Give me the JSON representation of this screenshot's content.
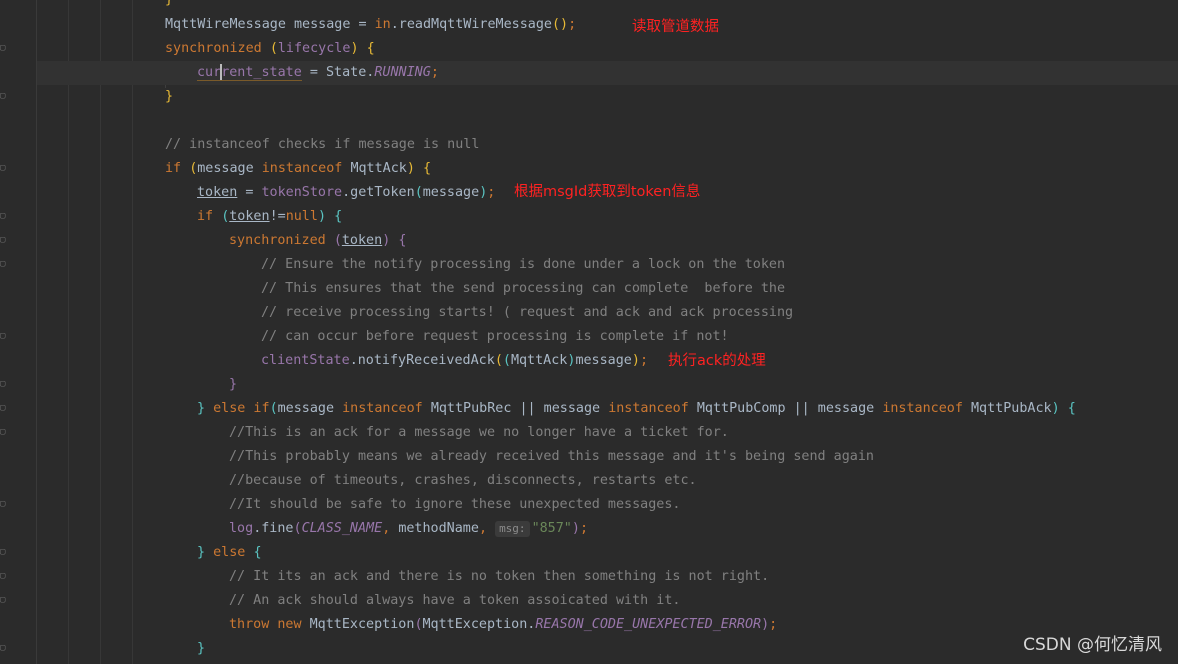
{
  "code": {
    "l0": {
      "a": "}"
    },
    "l1": {
      "t1": "MqttWireMessage message = ",
      "kin": "in",
      ".": ".",
      "call": "readMqttWireMessage",
      "p": "()",
      ";": ";"
    },
    "l2": {
      "kw": "synchronized ",
      "o": "(",
      "id": "lifecycle",
      "c": ")",
      " ": " ",
      "b": "{"
    },
    "l3": {
      "v1": "cur",
      "v2": "rent_state",
      "eq": " = State.",
      "run": "RUNNING",
      ";": ";"
    },
    "l4": {
      "b": "}"
    },
    "l5": {
      "c": "// instanceof checks if message is null"
    },
    "l6": {
      "kw": "if ",
      "o": "(",
      "m": "message ",
      "io": "instanceof ",
      "cls": "MqttAck",
      "c": ")",
      " ": " ",
      "b": "{"
    },
    "l7": {
      "tok": "token",
      "eq": " = ",
      "ts": "tokenStore",
      ".": ".getToken",
      "o": "(",
      "m": "message",
      "c": ")",
      ";": ";"
    },
    "l8": {
      "kw": "if ",
      "o": "(",
      "tok": "token",
      "ne": "!=",
      "nl": "null",
      "c": ")",
      " ": " ",
      "b": "{"
    },
    "l9": {
      "kw": "synchronized ",
      "o": "(",
      "tok": "token",
      "c": ")",
      " ": " ",
      "b": "{"
    },
    "l10": {
      "c": "// Ensure the notify processing is done under a lock on the token"
    },
    "l11": {
      "c": "// This ensures that the send processing can complete  before the"
    },
    "l12": {
      "c": "// receive processing starts! ( request and ack and ack processing"
    },
    "l13": {
      "c": "// can occur before request processing is complete if not!"
    },
    "l14": {
      "cs": "clientState",
      ".": ".notifyReceivedAck",
      "o": "(",
      "o2": "(",
      "cls": "MqttAck",
      "c2": ")",
      "m": "message",
      "c": ")",
      ";": ";"
    },
    "l15": {
      "b": "}"
    },
    "l16": {
      "b": "} ",
      "kw": "else if",
      "o": "(",
      "m1": "message ",
      "io1": "instanceof ",
      "c1": "MqttPubRec || message ",
      "io2": "instanceof ",
      "c2": "MqttPubComp || message ",
      "io3": "instanceof ",
      "c3": "MqttPubAck",
      "c": ")",
      " ": " ",
      "b2": "{"
    },
    "l17": {
      "c": "//This is an ack for a message we no longer have a ticket for."
    },
    "l18": {
      "c": "//This probably means we already received this message and it's being send again"
    },
    "l19": {
      "c": "//because of timeouts, crashes, disconnects, restarts etc."
    },
    "l20": {
      "c": "//It should be safe to ignore these unexpected messages."
    },
    "l21": {
      "lg": "log",
      ".": ".fine",
      "o": "(",
      "cn": "CLASS_NAME",
      ",": ", ",
      "mn": "methodName",
      ",2": ", ",
      "hint": "msg:",
      "s": "\"857\"",
      "c": ")",
      ";": ";"
    },
    "l22": {
      "b": "} ",
      "kw": "else ",
      "b2": "{"
    },
    "l23": {
      "c": "// It its an ack and there is no token then something is not right."
    },
    "l24": {
      "c": "// An ack should always have a token assoicated with it."
    },
    "l25": {
      "kw": "throw new ",
      "cls": "MqttException",
      "o": "(",
      "e": "MqttException.",
      "rc": "REASON_CODE_UNEXPECTED_ERROR",
      "c": ")",
      ";": ";"
    },
    "l26": {
      "b": "}"
    }
  },
  "annotations": {
    "a1": "读取管道数据",
    "a2": "根据msgId获取到token信息",
    "a3": "执行ack的处理"
  },
  "watermark": "CSDN @何忆清风",
  "colors": {
    "background": "#2b2b2b",
    "keyword": "#cc7832",
    "identifier": "#a9b7c6",
    "field": "#9876aa",
    "comment": "#808080",
    "string": "#6a8759",
    "annotation": "#ff2222"
  }
}
